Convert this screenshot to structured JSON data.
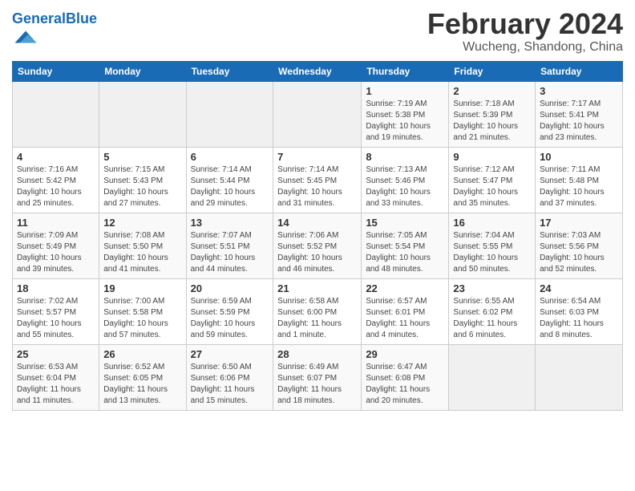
{
  "header": {
    "logo_general": "General",
    "logo_blue": "Blue",
    "month_title": "February 2024",
    "location": "Wucheng, Shandong, China"
  },
  "weekdays": [
    "Sunday",
    "Monday",
    "Tuesday",
    "Wednesday",
    "Thursday",
    "Friday",
    "Saturday"
  ],
  "weeks": [
    [
      {
        "day": "",
        "info": ""
      },
      {
        "day": "",
        "info": ""
      },
      {
        "day": "",
        "info": ""
      },
      {
        "day": "",
        "info": ""
      },
      {
        "day": "1",
        "info": "Sunrise: 7:19 AM\nSunset: 5:38 PM\nDaylight: 10 hours\nand 19 minutes."
      },
      {
        "day": "2",
        "info": "Sunrise: 7:18 AM\nSunset: 5:39 PM\nDaylight: 10 hours\nand 21 minutes."
      },
      {
        "day": "3",
        "info": "Sunrise: 7:17 AM\nSunset: 5:41 PM\nDaylight: 10 hours\nand 23 minutes."
      }
    ],
    [
      {
        "day": "4",
        "info": "Sunrise: 7:16 AM\nSunset: 5:42 PM\nDaylight: 10 hours\nand 25 minutes."
      },
      {
        "day": "5",
        "info": "Sunrise: 7:15 AM\nSunset: 5:43 PM\nDaylight: 10 hours\nand 27 minutes."
      },
      {
        "day": "6",
        "info": "Sunrise: 7:14 AM\nSunset: 5:44 PM\nDaylight: 10 hours\nand 29 minutes."
      },
      {
        "day": "7",
        "info": "Sunrise: 7:14 AM\nSunset: 5:45 PM\nDaylight: 10 hours\nand 31 minutes."
      },
      {
        "day": "8",
        "info": "Sunrise: 7:13 AM\nSunset: 5:46 PM\nDaylight: 10 hours\nand 33 minutes."
      },
      {
        "day": "9",
        "info": "Sunrise: 7:12 AM\nSunset: 5:47 PM\nDaylight: 10 hours\nand 35 minutes."
      },
      {
        "day": "10",
        "info": "Sunrise: 7:11 AM\nSunset: 5:48 PM\nDaylight: 10 hours\nand 37 minutes."
      }
    ],
    [
      {
        "day": "11",
        "info": "Sunrise: 7:09 AM\nSunset: 5:49 PM\nDaylight: 10 hours\nand 39 minutes."
      },
      {
        "day": "12",
        "info": "Sunrise: 7:08 AM\nSunset: 5:50 PM\nDaylight: 10 hours\nand 41 minutes."
      },
      {
        "day": "13",
        "info": "Sunrise: 7:07 AM\nSunset: 5:51 PM\nDaylight: 10 hours\nand 44 minutes."
      },
      {
        "day": "14",
        "info": "Sunrise: 7:06 AM\nSunset: 5:52 PM\nDaylight: 10 hours\nand 46 minutes."
      },
      {
        "day": "15",
        "info": "Sunrise: 7:05 AM\nSunset: 5:54 PM\nDaylight: 10 hours\nand 48 minutes."
      },
      {
        "day": "16",
        "info": "Sunrise: 7:04 AM\nSunset: 5:55 PM\nDaylight: 10 hours\nand 50 minutes."
      },
      {
        "day": "17",
        "info": "Sunrise: 7:03 AM\nSunset: 5:56 PM\nDaylight: 10 hours\nand 52 minutes."
      }
    ],
    [
      {
        "day": "18",
        "info": "Sunrise: 7:02 AM\nSunset: 5:57 PM\nDaylight: 10 hours\nand 55 minutes."
      },
      {
        "day": "19",
        "info": "Sunrise: 7:00 AM\nSunset: 5:58 PM\nDaylight: 10 hours\nand 57 minutes."
      },
      {
        "day": "20",
        "info": "Sunrise: 6:59 AM\nSunset: 5:59 PM\nDaylight: 10 hours\nand 59 minutes."
      },
      {
        "day": "21",
        "info": "Sunrise: 6:58 AM\nSunset: 6:00 PM\nDaylight: 11 hours\nand 1 minute."
      },
      {
        "day": "22",
        "info": "Sunrise: 6:57 AM\nSunset: 6:01 PM\nDaylight: 11 hours\nand 4 minutes."
      },
      {
        "day": "23",
        "info": "Sunrise: 6:55 AM\nSunset: 6:02 PM\nDaylight: 11 hours\nand 6 minutes."
      },
      {
        "day": "24",
        "info": "Sunrise: 6:54 AM\nSunset: 6:03 PM\nDaylight: 11 hours\nand 8 minutes."
      }
    ],
    [
      {
        "day": "25",
        "info": "Sunrise: 6:53 AM\nSunset: 6:04 PM\nDaylight: 11 hours\nand 11 minutes."
      },
      {
        "day": "26",
        "info": "Sunrise: 6:52 AM\nSunset: 6:05 PM\nDaylight: 11 hours\nand 13 minutes."
      },
      {
        "day": "27",
        "info": "Sunrise: 6:50 AM\nSunset: 6:06 PM\nDaylight: 11 hours\nand 15 minutes."
      },
      {
        "day": "28",
        "info": "Sunrise: 6:49 AM\nSunset: 6:07 PM\nDaylight: 11 hours\nand 18 minutes."
      },
      {
        "day": "29",
        "info": "Sunrise: 6:47 AM\nSunset: 6:08 PM\nDaylight: 11 hours\nand 20 minutes."
      },
      {
        "day": "",
        "info": ""
      },
      {
        "day": "",
        "info": ""
      }
    ]
  ]
}
